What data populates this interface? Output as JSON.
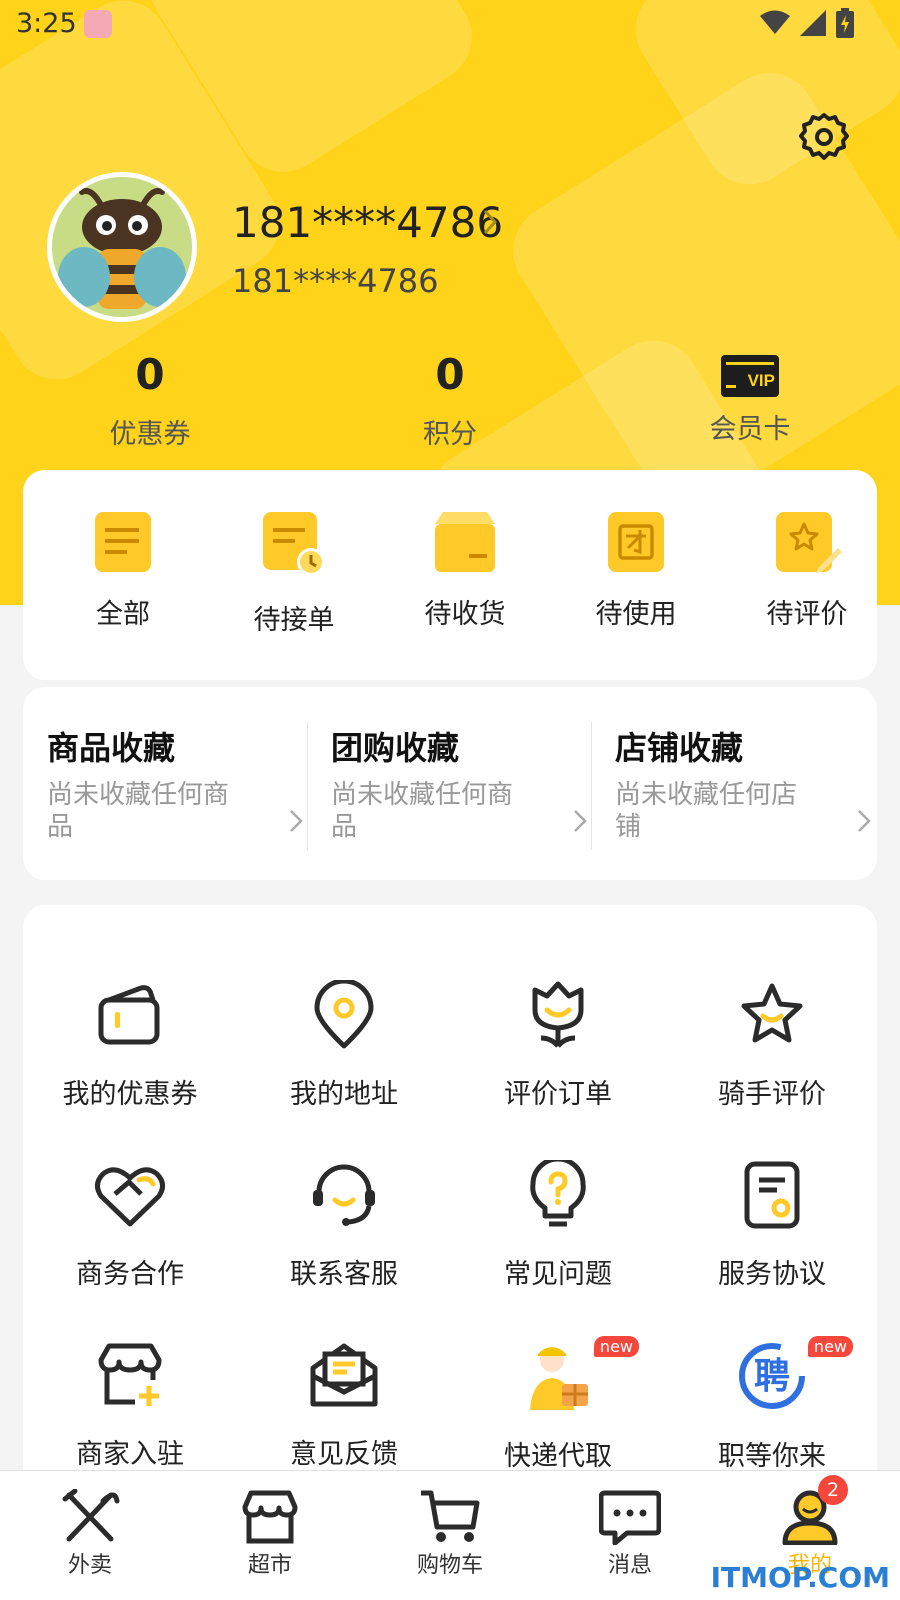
{
  "status_bar": {
    "time": "3:25"
  },
  "profile": {
    "username": "181****4786",
    "subtitle": "181****4786"
  },
  "stats": [
    {
      "value": "0",
      "label": "优惠券"
    },
    {
      "value": "0",
      "label": "积分"
    },
    {
      "badge": "VIP",
      "label": "会员卡"
    }
  ],
  "orders": [
    {
      "label": "全部",
      "icon": "order-all-icon"
    },
    {
      "label": "待接单",
      "icon": "order-pending-icon"
    },
    {
      "label": "待收货",
      "icon": "order-box-icon"
    },
    {
      "label": "待使用",
      "icon": "order-group-icon"
    },
    {
      "label": "待评价",
      "icon": "order-review-icon"
    }
  ],
  "favorites": [
    {
      "title": "商品收藏",
      "desc": "尚未收藏任何商品"
    },
    {
      "title": "团购收藏",
      "desc": "尚未收藏任何商品"
    },
    {
      "title": "店铺收藏",
      "desc": "尚未收藏任何店铺"
    }
  ],
  "services": [
    {
      "label": "我的优惠券",
      "icon": "wallet-icon"
    },
    {
      "label": "我的地址",
      "icon": "location-icon"
    },
    {
      "label": "评价订单",
      "icon": "tulip-icon"
    },
    {
      "label": "骑手评价",
      "icon": "star-icon"
    },
    {
      "label": "商务合作",
      "icon": "handshake-heart-icon"
    },
    {
      "label": "联系客服",
      "icon": "headset-icon"
    },
    {
      "label": "常见问题",
      "icon": "question-bulb-icon"
    },
    {
      "label": "服务协议",
      "icon": "document-icon"
    },
    {
      "label": "商家入驻",
      "icon": "store-add-icon"
    },
    {
      "label": "意见反馈",
      "icon": "mail-icon"
    },
    {
      "label": "快递代取",
      "icon": "courier-icon",
      "badge": "new"
    },
    {
      "label": "职等你来",
      "icon": "hire-icon",
      "badge": "new",
      "glyph": "聘"
    }
  ],
  "tabs": [
    {
      "label": "外卖",
      "icon": "fork-knife-icon"
    },
    {
      "label": "超市",
      "icon": "shop-icon"
    },
    {
      "label": "购物车",
      "icon": "cart-icon"
    },
    {
      "label": "消息",
      "icon": "message-icon"
    },
    {
      "label": "我的",
      "icon": "profile-icon",
      "badge": "2",
      "active": true
    }
  ],
  "watermark": "ITMOP.COM",
  "colors": {
    "brand_yellow": "#ffd31a",
    "icon_yellow": "#ffc928",
    "badge_red": "#f5473b",
    "dark": "#2b2b2b"
  }
}
